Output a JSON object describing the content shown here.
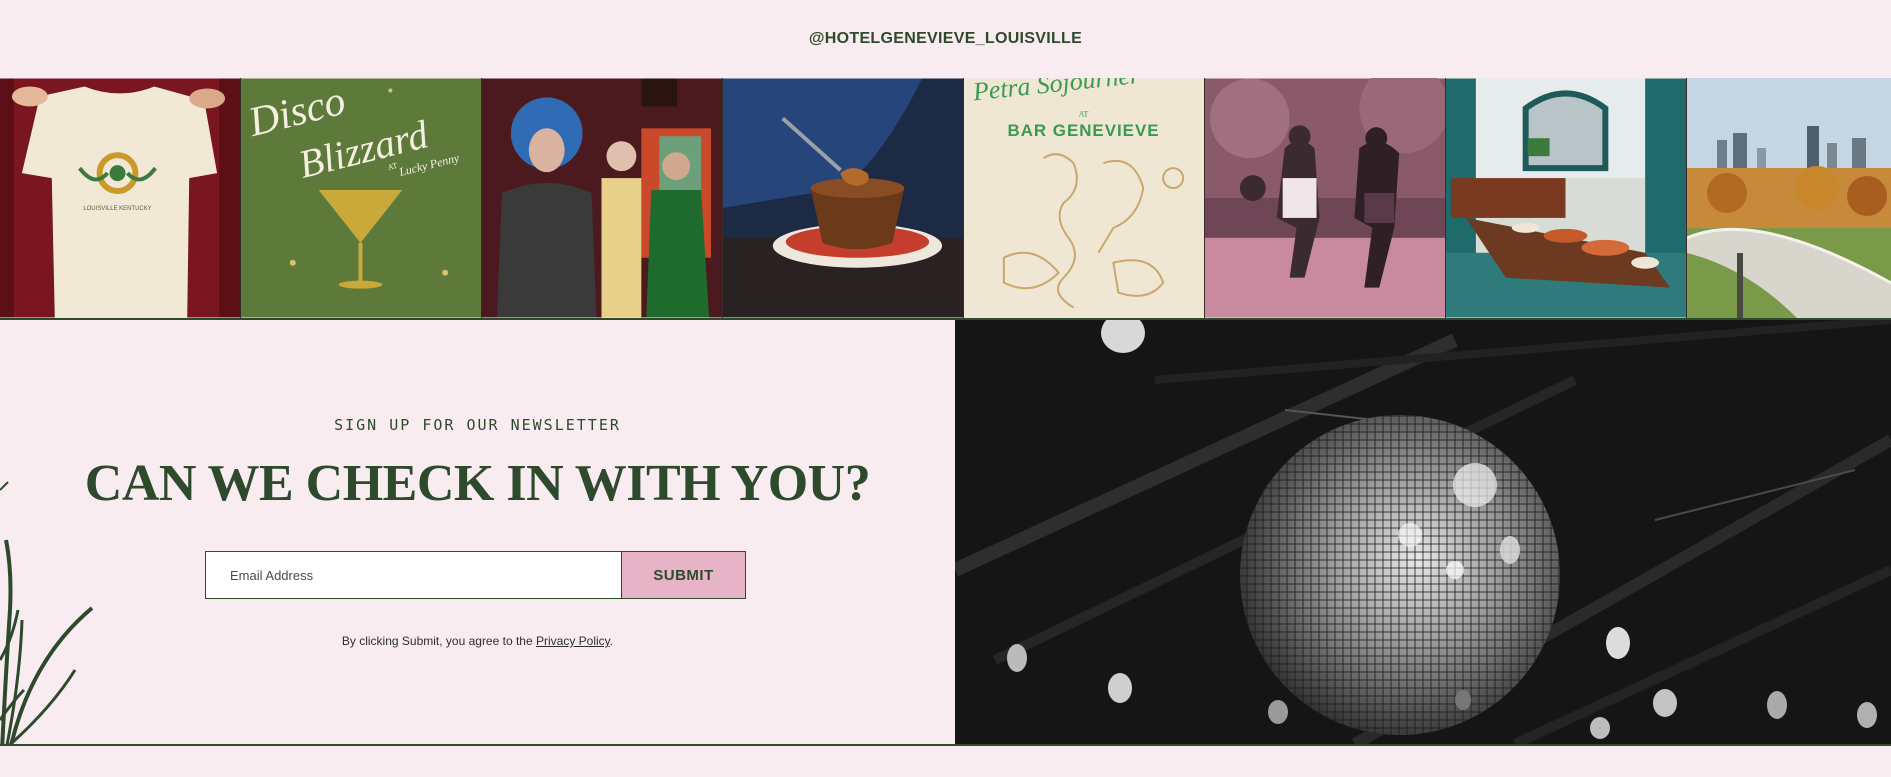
{
  "instagram": {
    "handle": "@HOTELGENEVIEVE_LOUISVILLE",
    "tiles": [
      {
        "name": "louisville-tshirt",
        "text": [
          "LOUISVILLE KENTUCKY"
        ]
      },
      {
        "name": "disco-blizzard-poster",
        "text": [
          "Disco",
          "Blizzard",
          "AT",
          "Lucky Penny"
        ]
      },
      {
        "name": "drag-performers-photo",
        "text": []
      },
      {
        "name": "dessert-bowl-photo",
        "text": []
      },
      {
        "name": "bar-genevieve-poster",
        "text": [
          "Petra Sojourner",
          "AT",
          "BAR GENEVIEVE"
        ]
      },
      {
        "name": "basketball-players-photo",
        "text": []
      },
      {
        "name": "buffet-dining-room-photo",
        "text": []
      },
      {
        "name": "louisville-skyline-bridge-photo",
        "text": []
      }
    ]
  },
  "newsletter": {
    "eyebrow": "SIGN UP FOR OUR NEWSLETTER",
    "headline": "CAN WE CHECK IN WITH YOU?",
    "email_placeholder": "Email Address",
    "submit_label": "SUBMIT",
    "consent_prefix": "By clicking Submit, you agree to the",
    "privacy_link": "Privacy Policy",
    "consent_suffix": "."
  },
  "colors": {
    "brand_green": "#2e4a2c",
    "background_pink": "#f8ecf0",
    "button_pink": "#e6b3c7"
  }
}
